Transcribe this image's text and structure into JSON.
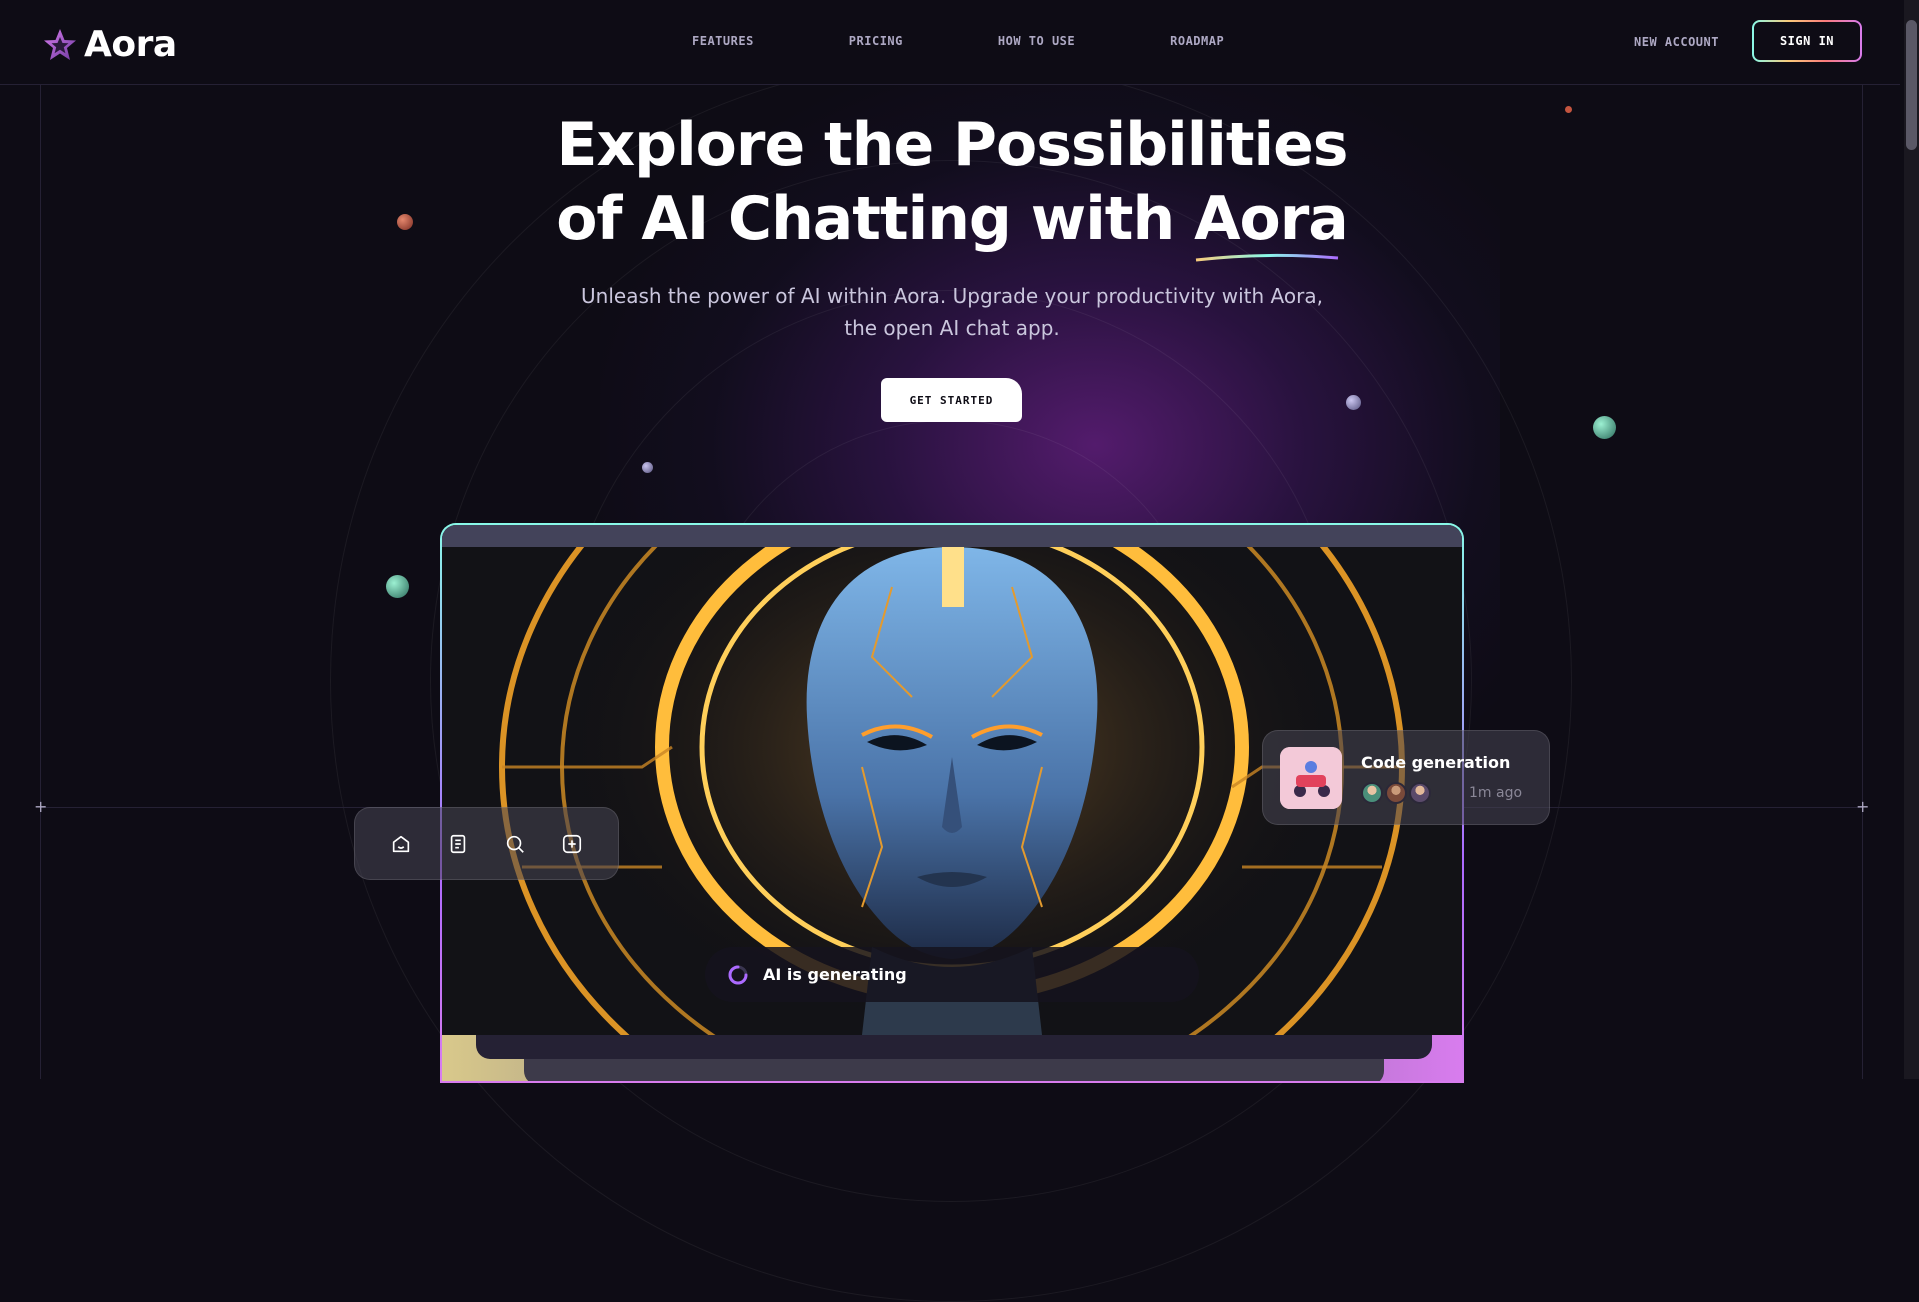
{
  "header": {
    "logo_text": "Aora",
    "nav": [
      "FEATURES",
      "PRICING",
      "HOW TO USE",
      "ROADMAP"
    ],
    "new_account": "NEW ACCOUNT",
    "sign_in": "SIGN IN"
  },
  "hero": {
    "title_line1": "Explore the Possibilities",
    "title_line2_prefix": "of AI Chatting with ",
    "title_highlight": "Aora",
    "subtitle_line1": "Unleash the power of AI within Aora. Upgrade your productivity with Aora,",
    "subtitle_line2": "the open AI chat app.",
    "cta": "GET STARTED"
  },
  "preview": {
    "status": "AI is generating",
    "toolbar_icons": [
      "home-icon",
      "file-icon",
      "search-icon",
      "plus-square-icon"
    ],
    "notification": {
      "title": "Code generation",
      "time": "1m ago"
    }
  },
  "colors": {
    "background": "#0e0c15",
    "border": "#252134",
    "accent_purple": "#ac6aff",
    "accent_teal": "#89f9e8"
  }
}
